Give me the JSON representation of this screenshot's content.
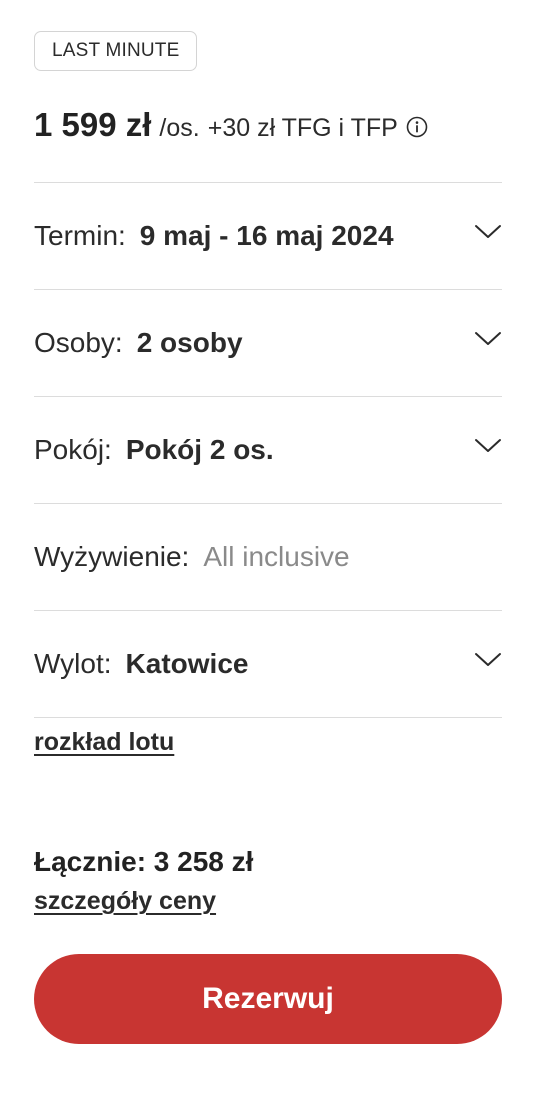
{
  "badge": {
    "label": "LAST MINUTE"
  },
  "price": {
    "main": "1 599 zł",
    "per_person": "/os.",
    "extra": "+30 zł TFG i TFP",
    "info_icon": "info-circle-icon"
  },
  "fields": [
    {
      "label": "Termin:",
      "value": "9 maj - 16 maj 2024",
      "has_dropdown": true
    },
    {
      "label": "Osoby:",
      "value": "2 osoby",
      "has_dropdown": true
    },
    {
      "label": "Pokój:",
      "value": "Pokój 2 os.",
      "has_dropdown": true
    },
    {
      "label": "Wyżywienie:",
      "value": "All inclusive",
      "has_dropdown": false
    },
    {
      "label": "Wylot:",
      "value": "Katowice",
      "has_dropdown": true
    }
  ],
  "flight_schedule_link": "rozkład lotu",
  "total": {
    "text": "Łącznie: 3 258 zł"
  },
  "price_details_link": "szczegóły ceny",
  "book_button": "Rezerwuj",
  "colors": {
    "accent": "#c83532",
    "text": "#2b2b2b",
    "muted": "#8a8a8a",
    "divider": "#dcdcdc"
  }
}
